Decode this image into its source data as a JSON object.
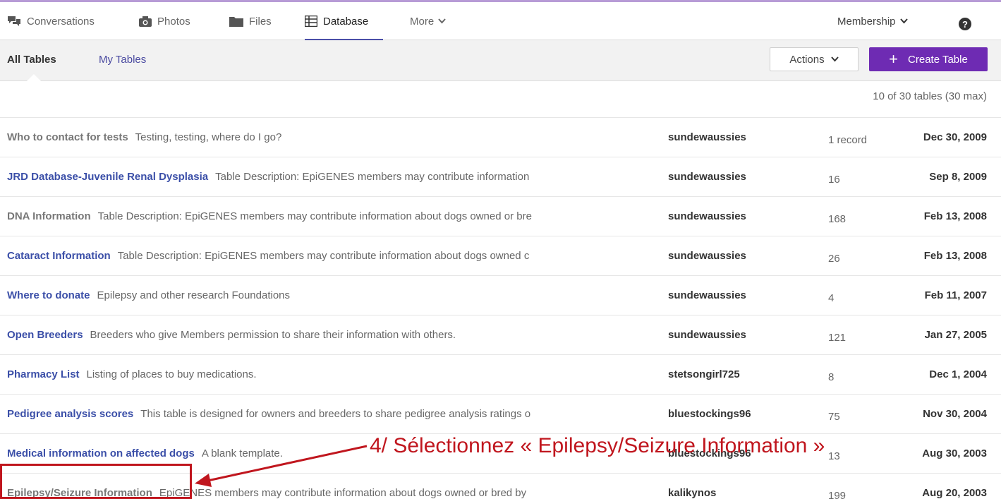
{
  "nav": {
    "items": [
      {
        "label": "Conversations",
        "icon": "conversations-icon"
      },
      {
        "label": "Photos",
        "icon": "camera-icon"
      },
      {
        "label": "Files",
        "icon": "folder-icon"
      },
      {
        "label": "Database",
        "icon": "table-icon"
      },
      {
        "label": "More",
        "icon": "chevron-down-icon"
      }
    ],
    "membership_label": "Membership",
    "help_glyph": "?"
  },
  "subbar": {
    "tab_all": "All Tables",
    "tab_mine": "My Tables",
    "actions_label": "Actions",
    "create_label": "Create Table",
    "create_plus": "+"
  },
  "count_text": "10 of 30 tables (30 max)",
  "rows": [
    {
      "name": "Who to contact for tests",
      "desc": "Testing, testing, where do I go?",
      "owner": "sundewaussies",
      "records": "1 record",
      "date": "Dec 30, 2009"
    },
    {
      "name": "JRD Database-Juvenile Renal Dysplasia",
      "desc": "Table Description: EpiGENES members may contribute information",
      "owner": "sundewaussies",
      "records": "16",
      "date": "Sep 8, 2009"
    },
    {
      "name": "DNA Information",
      "desc": "Table Description: EpiGENES members may contribute information about dogs owned or bre",
      "owner": "sundewaussies",
      "records": "168",
      "date": "Feb 13, 2008"
    },
    {
      "name": "Cataract Information",
      "desc": "Table Description: EpiGENES members may contribute information about dogs owned c",
      "owner": "sundewaussies",
      "records": "26",
      "date": "Feb 13, 2008"
    },
    {
      "name": "Where to donate",
      "desc": "Epilepsy and other research Foundations",
      "owner": "sundewaussies",
      "records": "4",
      "date": "Feb 11, 2007"
    },
    {
      "name": "Open Breeders",
      "desc": "Breeders who give Members permission to share their information with others.",
      "owner": "sundewaussies",
      "records": "121",
      "date": "Jan 27, 2005"
    },
    {
      "name": "Pharmacy List",
      "desc": "Listing of places to buy medications.",
      "owner": "stetsongirl725",
      "records": "8",
      "date": "Dec 1, 2004"
    },
    {
      "name": "Pedigree analysis scores",
      "desc": "This table is designed for owners and breeders to share pedigree analysis ratings o",
      "owner": "bluestockings96",
      "records": "75",
      "date": "Nov 30, 2004"
    },
    {
      "name": "Medical information on affected dogs",
      "desc": "A blank template.",
      "owner": "bluestockings96",
      "records": "13",
      "date": "Aug 30, 2003"
    },
    {
      "name": "Epilepsy/Seizure Information",
      "desc": "EpiGENES members may contribute information about dogs owned or bred by",
      "owner": "kalikynos",
      "records": "199",
      "date": "Aug 20, 2003"
    }
  ],
  "annotation": "4/ Sélectionnez « Epilepsy/Seizure Information »",
  "colors": {
    "accent": "#6e2bb3",
    "link": "#3b4fa8",
    "annotation": "#c0161e"
  }
}
